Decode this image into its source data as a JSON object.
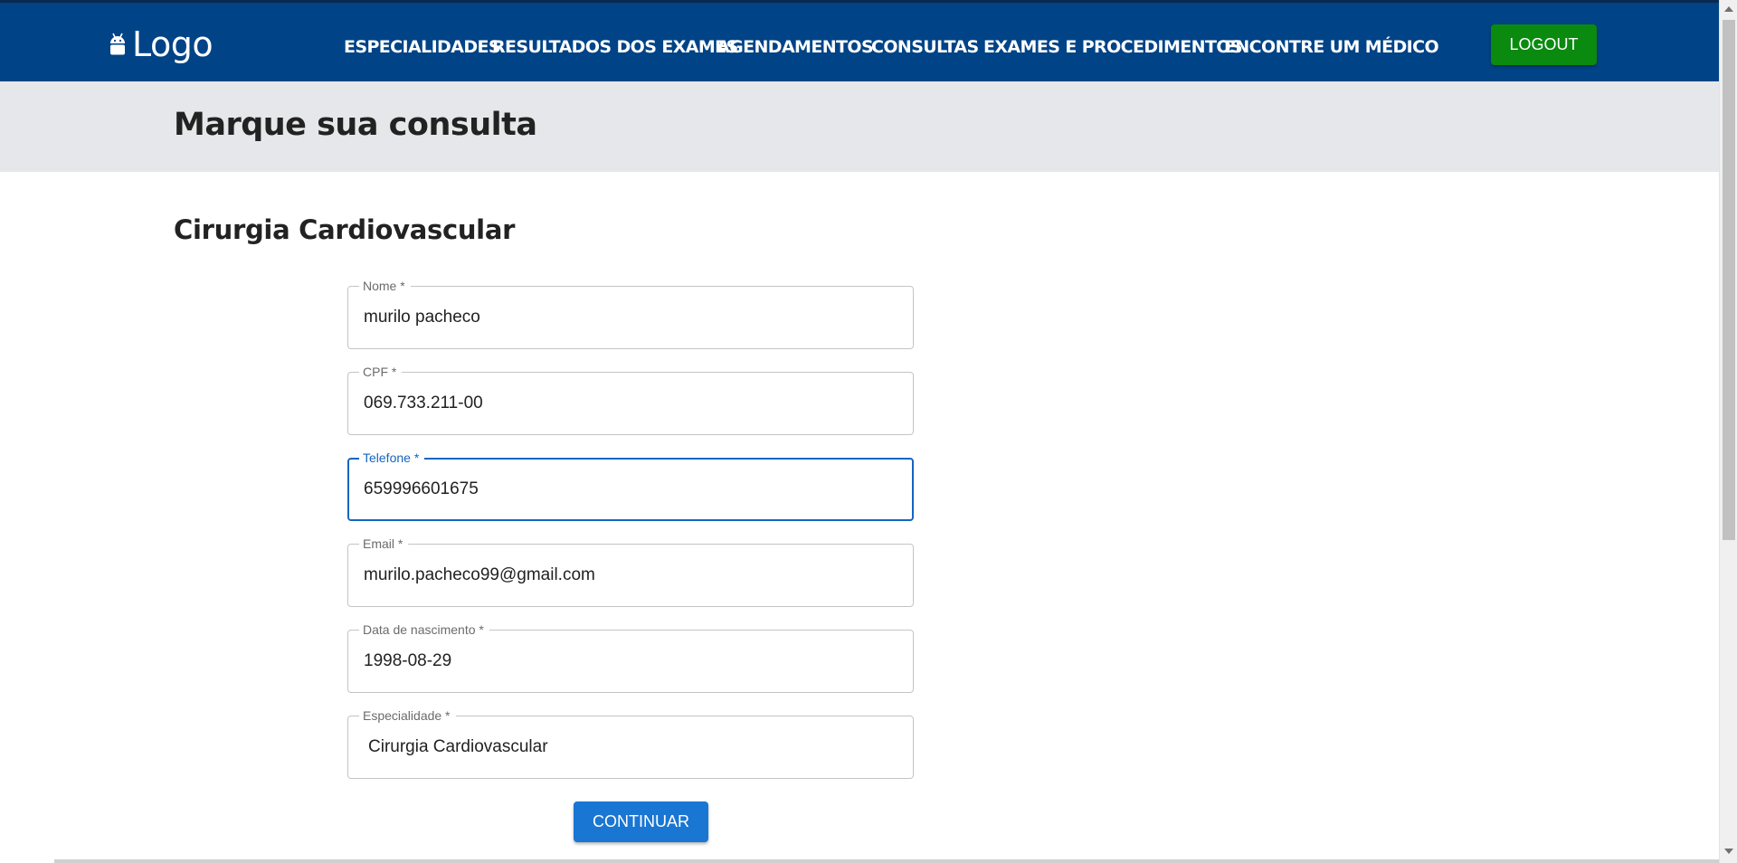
{
  "header": {
    "logo_text": "Logo",
    "nav": [
      {
        "label": "ESPECIALIDADES"
      },
      {
        "label": "RESULTADOS DOS EXAMES"
      },
      {
        "label": "AGENDAMENTOS"
      },
      {
        "label": "CONSULTAS"
      },
      {
        "label": "EXAMES E PROCEDIMENTOS"
      },
      {
        "label": "ENCONTRE UM MÉDICO"
      }
    ],
    "logout_label": "LOGOUT"
  },
  "hero": {
    "title": "Marque sua consulta"
  },
  "form": {
    "subtitle": "Cirurgia Cardiovascular",
    "fields": {
      "nome": {
        "label": "Nome *",
        "value": "murilo pacheco"
      },
      "cpf": {
        "label": "CPF *",
        "value": "069.733.211-00"
      },
      "telefone": {
        "label": "Telefone *",
        "value": "659996601675"
      },
      "email": {
        "label": "Email *",
        "value": "murilo.pacheco99@gmail.com"
      },
      "nascimento": {
        "label": "Data de nascimento *",
        "value": "1998-08-29"
      },
      "especialidade": {
        "label": "Especialidade *",
        "value": "Cirurgia Cardiovascular"
      }
    },
    "continue_label": "CONTINUAR"
  },
  "colors": {
    "header_bg": "#004386",
    "logout_bg": "#0a8a0f",
    "primary": "#1976d2",
    "hero_bg": "#e6e7ea"
  },
  "icons": {
    "logo": "android-icon"
  }
}
